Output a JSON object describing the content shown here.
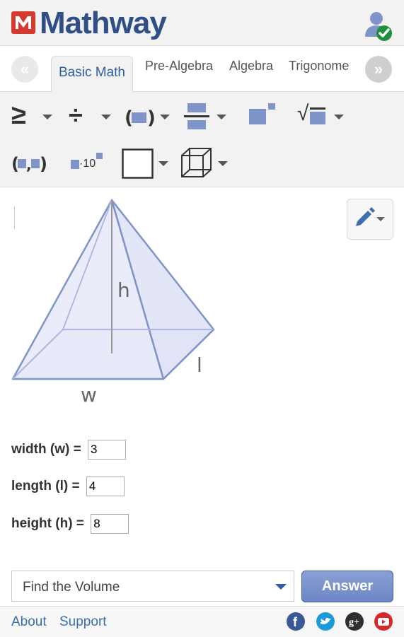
{
  "header": {
    "logo_text": "Mathway",
    "logo_icon": "mathway-logo-icon",
    "user_icon": "user-verified-icon"
  },
  "tabs": {
    "prev_icon": "chevron-double-left-icon",
    "next_icon": "chevron-double-right-icon",
    "items": [
      {
        "label": "Basic Math",
        "active": true
      },
      {
        "label": "Pre-Algebra",
        "active": false
      },
      {
        "label": "Algebra",
        "active": false
      },
      {
        "label": "Trigonome",
        "active": false
      }
    ]
  },
  "toolbar": {
    "ge_symbol": "≥",
    "div_symbol": "÷",
    "sqrt_symbol": "√",
    "sci_label": "·10",
    "tools": [
      "inequality-tool",
      "division-tool",
      "parentheses-tool",
      "fraction-tool",
      "exponent-tool",
      "root-tool",
      "point-tool",
      "scientific-notation-tool",
      "square-tool",
      "cube-tool"
    ]
  },
  "figure": {
    "label_h": "h",
    "label_l": "l",
    "label_w": "w"
  },
  "fields": {
    "width_label": "width (w) =",
    "width_value": "3",
    "length_label": "length (l) =",
    "length_value": "4",
    "height_label": "height (h) =",
    "height_value": "8"
  },
  "action": {
    "select_value": "Find the Volume",
    "answer_label": "Answer"
  },
  "footer": {
    "about": "About",
    "support": "Support",
    "social_icons": [
      "facebook-icon",
      "twitter-icon",
      "google-plus-icon",
      "youtube-icon"
    ]
  },
  "colors": {
    "brand_blue": "#2f4f86",
    "logo_red": "#d63a2f",
    "accent_blue": "#2f5fa3",
    "shape_fill": "#e6e9f8",
    "shape_stroke": "#7f94c8"
  }
}
